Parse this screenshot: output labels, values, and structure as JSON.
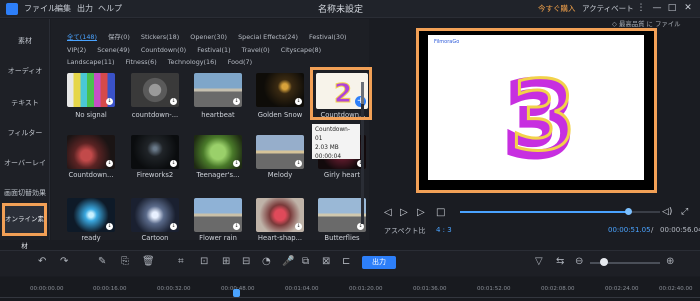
{
  "titlebar": {
    "menus": [
      "ファイル",
      "編集",
      "出力",
      "ヘルプ"
    ],
    "title": "名称未設定",
    "buy": "今すぐ購入",
    "activate": "アクティベート",
    "controls": [
      "⋮",
      "—",
      "□",
      "✕"
    ]
  },
  "leftnav": {
    "items": [
      "素材",
      "オーディオ",
      "テキスト",
      "フィルター",
      "オーバーレイ",
      "画面切替効果"
    ],
    "active": "オンライン素材"
  },
  "categories": [
    "全て(148)",
    "保存(0)",
    "Stickers(18)",
    "Opener(30)",
    "Special Effects(24)",
    "Festival(30)",
    "VIP(2)",
    "Scene(49)",
    "Countdown(0)",
    "Festival(1)",
    "Travel(0)",
    "Cityscape(8)",
    "Landscape(11)",
    "Fitness(6)",
    "Technology(16)",
    "Food(7)"
  ],
  "media_items": [
    {
      "label": "No signal"
    },
    {
      "label": "countdown-..."
    },
    {
      "label": "heartbeat"
    },
    {
      "label": "Golden Snow"
    },
    {
      "label": "Countdown..."
    },
    {
      "label": "Countdown..."
    },
    {
      "label": "Fireworks2"
    },
    {
      "label": "Teenager's..."
    },
    {
      "label": "Melody"
    },
    {
      "label": "Girly heart"
    },
    {
      "label": "ready"
    },
    {
      "label": "Cartoon"
    },
    {
      "label": "Flower rain"
    },
    {
      "label": "Heart-shap..."
    },
    {
      "label": "Butterflies"
    }
  ],
  "tooltip": {
    "name": "Countdown-01",
    "size": "2.03 MB",
    "duration": "00:00:04"
  },
  "preview": {
    "ratio_label": "◇ 最高品質 に ファイル 12:37",
    "thumb_brand": "FilmoraGo",
    "big_number": "3"
  },
  "player": {
    "aspect_label": "アスペクト比",
    "aspect_value": "4 : 3",
    "current_time": "00:00:51.05",
    "separator": "/",
    "total_time": "00:00:56.04",
    "progress": 0.84
  },
  "toolbar": {
    "export_label": "出力",
    "zoom_level": 0.2
  },
  "ruler": {
    "ticks": [
      "00:00:00.00",
      "00:00:16.00",
      "00:00:32.00",
      "00:00:48.00",
      "00:01:04.00",
      "00:01:20.00",
      "00:01:36.00",
      "00:01:52.00",
      "00:02:08.00",
      "00:02:24.00",
      "00:02:40.00"
    ]
  },
  "colors": {
    "accent": "#2d7ff9",
    "highlight": "#f2a056",
    "link": "#4aa3ff"
  }
}
